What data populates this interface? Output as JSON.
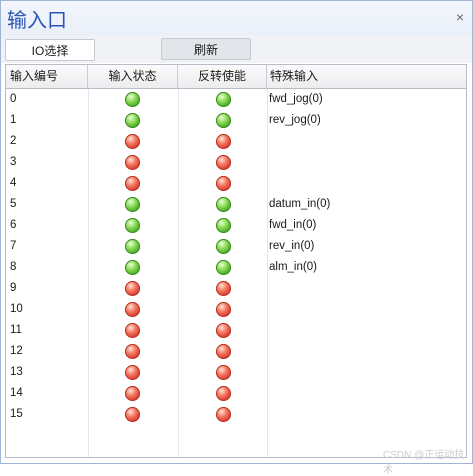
{
  "window": {
    "title": "输入口",
    "close_glyph": "×"
  },
  "toolbar": {
    "io_select_label": "IO选择",
    "refresh_label": "刷新"
  },
  "table": {
    "headers": [
      "输入编号",
      "输入状态",
      "反转使能",
      "特殊输入"
    ],
    "rows": [
      {
        "num": "0",
        "state": "on",
        "invert": "on",
        "special": "fwd_jog(0)"
      },
      {
        "num": "1",
        "state": "on",
        "invert": "on",
        "special": "rev_jog(0)"
      },
      {
        "num": "2",
        "state": "off",
        "invert": "off",
        "special": ""
      },
      {
        "num": "3",
        "state": "off",
        "invert": "off",
        "special": ""
      },
      {
        "num": "4",
        "state": "off",
        "invert": "off",
        "special": ""
      },
      {
        "num": "5",
        "state": "on",
        "invert": "on",
        "special": "datum_in(0)"
      },
      {
        "num": "6",
        "state": "on",
        "invert": "on",
        "special": "fwd_in(0)"
      },
      {
        "num": "7",
        "state": "on",
        "invert": "on",
        "special": "rev_in(0)"
      },
      {
        "num": "8",
        "state": "on",
        "invert": "on",
        "special": "alm_in(0)"
      },
      {
        "num": "9",
        "state": "off",
        "invert": "off",
        "special": ""
      },
      {
        "num": "10",
        "state": "off",
        "invert": "off",
        "special": ""
      },
      {
        "num": "11",
        "state": "off",
        "invert": "off",
        "special": ""
      },
      {
        "num": "12",
        "state": "off",
        "invert": "off",
        "special": ""
      },
      {
        "num": "13",
        "state": "off",
        "invert": "off",
        "special": ""
      },
      {
        "num": "14",
        "state": "off",
        "invert": "off",
        "special": ""
      },
      {
        "num": "15",
        "state": "off",
        "invert": "off",
        "special": ""
      }
    ]
  },
  "indicator_colors": {
    "on": "#3ea51d",
    "off": "#d6332a"
  },
  "icons": {
    "led_on": "green-led-icon",
    "led_off": "red-led-icon",
    "close": "close-icon"
  },
  "watermark": "CSDN @正运动技术"
}
